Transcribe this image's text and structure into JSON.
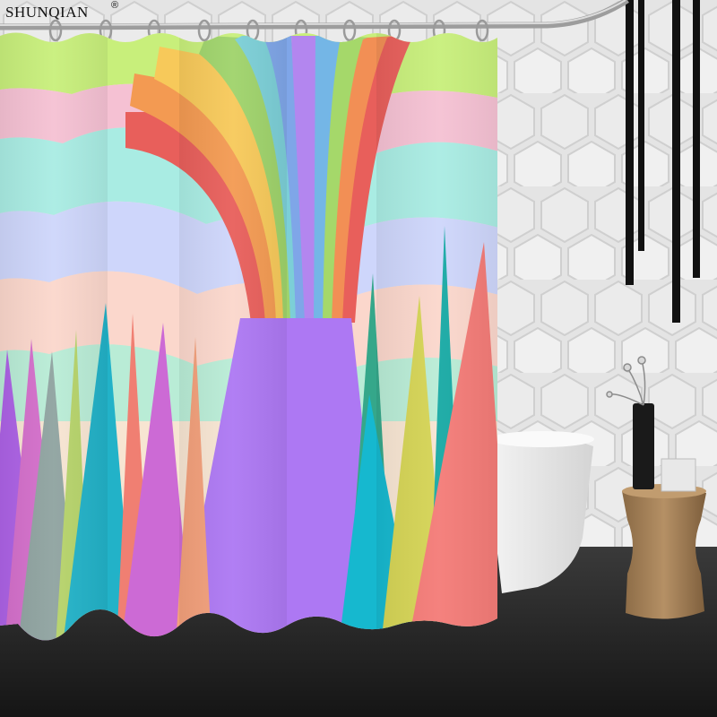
{
  "brand": {
    "name": "SHUNQIAN",
    "mark": "®"
  },
  "scene": {
    "subject": "shower-curtain",
    "colors": {
      "wall": "#e6e6e6",
      "floor": "#1e1e1e",
      "rainbow": [
        "#e85f5b",
        "#f39a52",
        "#f7c95a",
        "#9fd36b",
        "#7ccfd7",
        "#7fa6e8",
        "#b386ef"
      ],
      "volcano": "#ad78f3",
      "trees": [
        "#ad62e6",
        "#22b2c8",
        "#f07f72",
        "#8fa3a0",
        "#f3a07b",
        "#d46fcb",
        "#35a78a",
        "#d5d455",
        "#17a9a4",
        "#f47b77"
      ]
    }
  }
}
